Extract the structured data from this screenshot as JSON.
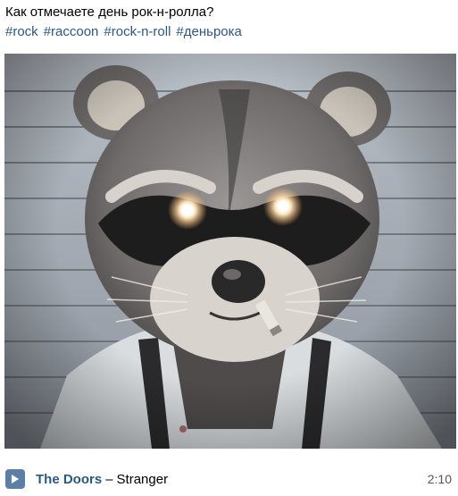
{
  "post": {
    "text": "Как отмечаете день рок-н-ролла?",
    "hashtags": [
      "#rock",
      "#raccoon",
      "#rock-n-roll",
      "#деньрока"
    ]
  },
  "photo": {
    "subject": "raccoon-mugshot"
  },
  "audio": {
    "artist": "The Doors",
    "separator": "–",
    "title": "Stranger",
    "duration": "2:10",
    "icon": "play-icon"
  },
  "colors": {
    "link": "#2a5885",
    "play_button": "#5b7fa6"
  }
}
